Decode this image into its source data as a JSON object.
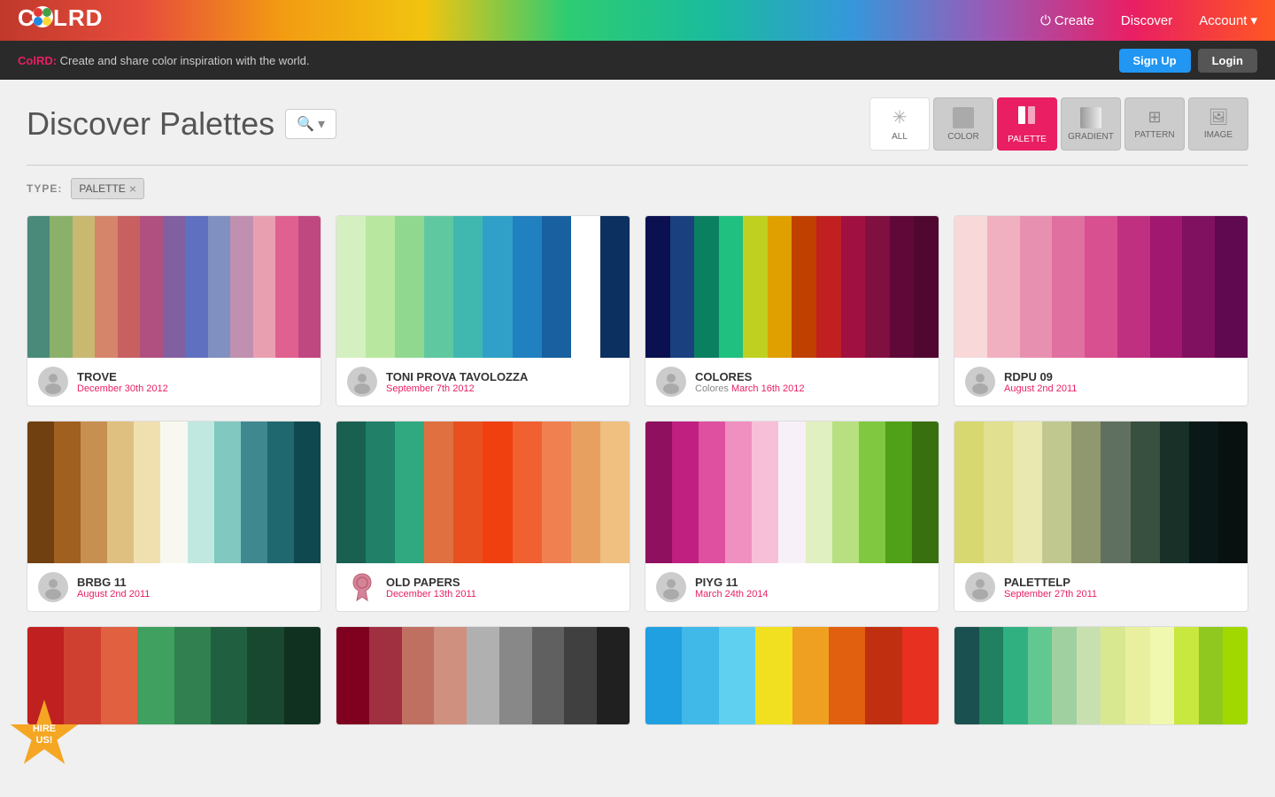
{
  "header": {
    "logo_text": "C●LRD",
    "logo_display": "COLRD",
    "nav_create": "Create",
    "nav_discover": "Discover",
    "nav_account": "Account"
  },
  "banner": {
    "brand": "ColRD:",
    "text": " Create and share color inspiration with the world.",
    "signup_label": "Sign Up",
    "login_label": "Login"
  },
  "page": {
    "title": "Discover Palettes",
    "search_placeholder": "🔍▾"
  },
  "filter_tabs": [
    {
      "id": "all",
      "icon": "✳",
      "label": "ALL"
    },
    {
      "id": "color",
      "icon": "⬛",
      "label": "COLOR"
    },
    {
      "id": "palette",
      "icon": "▌▌",
      "label": "PALETTE",
      "active": true
    },
    {
      "id": "gradient",
      "icon": "⬛",
      "label": "GRADIENT"
    },
    {
      "id": "pattern",
      "icon": "⊞",
      "label": "PATTERN"
    },
    {
      "id": "image",
      "icon": "🖼",
      "label": "IMAGE"
    }
  ],
  "type_filter": {
    "label": "TYPE:",
    "tag": "PALETTE",
    "close": "×"
  },
  "palettes": [
    {
      "id": "trove",
      "name": "TROVE",
      "date": "December 30th 2012",
      "category": "",
      "avatar_type": "person",
      "colors": [
        "#4a8a7a",
        "#8ab06a",
        "#c8b870",
        "#d4856a",
        "#c86060",
        "#b05080",
        "#8060a0",
        "#6070c0",
        "#8090c0",
        "#c090b0",
        "#e8a0b0",
        "#e06090",
        "#c04880"
      ]
    },
    {
      "id": "toni-prova",
      "name": "TONI PROVA TAVOLOZZA",
      "date": "September 7th 2012",
      "category": "",
      "avatar_type": "person",
      "colors": [
        "#d4f0c0",
        "#b8e8a0",
        "#90d890",
        "#60c8a0",
        "#40b8b0",
        "#30a0c8",
        "#2080c0",
        "#1860a0",
        "#1040808",
        "#0c3060"
      ]
    },
    {
      "id": "colores",
      "name": "COLORES",
      "date": "March 16th 2012",
      "category": "Colores ",
      "avatar_type": "person",
      "colors": [
        "#0a1050",
        "#1a4080",
        "#0a8060",
        "#20c080",
        "#c0d020",
        "#e0a000",
        "#c04000",
        "#c02020",
        "#a01040",
        "#801040",
        "#600838",
        "#500830"
      ]
    },
    {
      "id": "rdpu09",
      "name": "RDPU 09",
      "date": "August 2nd 2011",
      "category": "",
      "avatar_type": "person",
      "colors": [
        "#f8d8d8",
        "#f0b0c0",
        "#e890b0",
        "#e070a0",
        "#d85090",
        "#c03080",
        "#a01870",
        "#801060",
        "#600850"
      ]
    },
    {
      "id": "brbg11",
      "name": "BRBG 11",
      "date": "August 2nd 2011",
      "category": "",
      "avatar_type": "person",
      "colors": [
        "#704010",
        "#a06020",
        "#c89050",
        "#e0c080",
        "#f0e0b0",
        "#f8f8f0",
        "#c0e8e0",
        "#80c8c0",
        "#408890",
        "#206870",
        "#104850"
      ]
    },
    {
      "id": "old-papers",
      "name": "OLD PAPERS",
      "date": "December 13th 2011",
      "category": "",
      "avatar_type": "ribbon",
      "colors": [
        "#1a6050",
        "#208068",
        "#30a880",
        "#e07040",
        "#e85020",
        "#f04010",
        "#f06030",
        "#f08050",
        "#e8a060",
        "#f0c080"
      ]
    },
    {
      "id": "piyg11",
      "name": "PIYG 11",
      "date": "March 24th 2014",
      "category": "",
      "avatar_type": "person",
      "colors": [
        "#901060",
        "#c02080",
        "#e050a0",
        "#f090c0",
        "#f8c0d8",
        "#f8f0f8",
        "#e0f0c0",
        "#b8e080",
        "#80c840",
        "#50a018",
        "#387010"
      ]
    },
    {
      "id": "palettelp",
      "name": "PALETTELP",
      "date": "September 27th 2011",
      "category": "",
      "avatar_type": "person",
      "colors": [
        "#d8d870",
        "#e0e090",
        "#e8e8b0",
        "#c0c890",
        "#909870",
        "#607060",
        "#385040",
        "#183028",
        "#0a1818",
        "#081010"
      ]
    },
    {
      "id": "partial1",
      "name": "",
      "date": "",
      "category": "",
      "avatar_type": "",
      "colors": [
        "#c02020",
        "#d04030",
        "#e06040",
        "#40a060",
        "#308050",
        "#206040",
        "#184830",
        "#103020"
      ]
    },
    {
      "id": "partial2",
      "name": "",
      "date": "",
      "category": "",
      "avatar_type": "",
      "colors": [
        "#800020",
        "#a03040",
        "#c07060",
        "#d09080",
        "#b0b0b0",
        "#888888",
        "#606060",
        "#404040",
        "#202020"
      ]
    },
    {
      "id": "partial3",
      "name": "",
      "date": "",
      "category": "",
      "avatar_type": "",
      "colors": [
        "#20a0e0",
        "#40b8e8",
        "#60d0f0",
        "#f0e020",
        "#f0a020",
        "#e06010",
        "#c03010",
        "#e83020"
      ]
    },
    {
      "id": "partial4",
      "name": "",
      "date": "",
      "category": "",
      "avatar_type": "",
      "colors": [
        "#1a5050",
        "#208060",
        "#30b080",
        "#60c890",
        "#a0d0a0",
        "#c8e0b0",
        "#d8e890",
        "#e8f0a0",
        "#f0f8b0",
        "#c8e840",
        "#90c820",
        "#a0d800"
      ]
    }
  ],
  "hire_badge": {
    "line1": "HIRE",
    "line2": "US!"
  }
}
